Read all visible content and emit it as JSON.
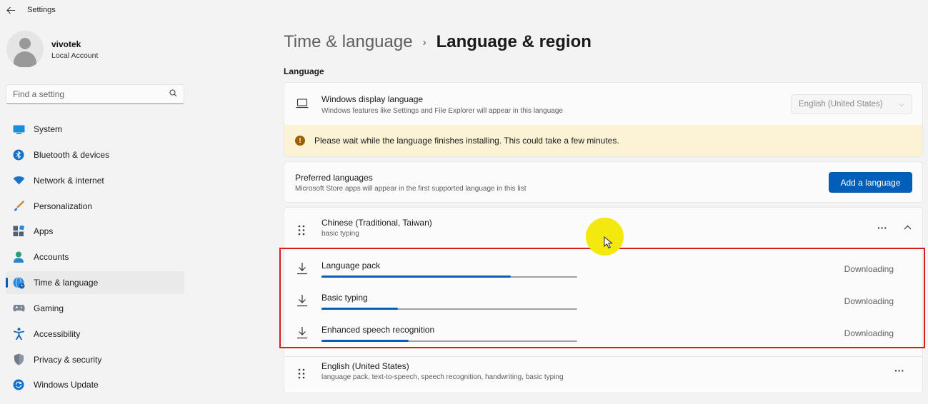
{
  "app": {
    "title": "Settings"
  },
  "user": {
    "name": "vivotek",
    "account_type": "Local Account"
  },
  "search": {
    "placeholder": "Find a setting"
  },
  "nav": {
    "items": [
      {
        "label": "System",
        "icon": "monitor-icon"
      },
      {
        "label": "Bluetooth & devices",
        "icon": "bluetooth-icon"
      },
      {
        "label": "Network & internet",
        "icon": "wifi-icon"
      },
      {
        "label": "Personalization",
        "icon": "brush-icon"
      },
      {
        "label": "Apps",
        "icon": "apps-icon"
      },
      {
        "label": "Accounts",
        "icon": "person-icon"
      },
      {
        "label": "Time & language",
        "icon": "globe-clock-icon",
        "active": true
      },
      {
        "label": "Gaming",
        "icon": "gamepad-icon"
      },
      {
        "label": "Accessibility",
        "icon": "accessibility-icon"
      },
      {
        "label": "Privacy & security",
        "icon": "shield-icon"
      },
      {
        "label": "Windows Update",
        "icon": "update-icon"
      }
    ]
  },
  "breadcrumb": {
    "parent": "Time & language",
    "separator": "›",
    "current": "Language & region"
  },
  "language_section": {
    "label": "Language",
    "display_language": {
      "title": "Windows display language",
      "subtitle": "Windows features like Settings and File Explorer will appear in this language",
      "value": "English (United States)"
    },
    "warning": "Please wait while the language finishes installing. This could take a few minutes.",
    "preferred": {
      "title": "Preferred languages",
      "subtitle": "Microsoft Store apps will appear in the first supported language in this list",
      "add_button": "Add a language"
    },
    "languages": [
      {
        "name": "Chinese (Traditional, Taiwan)",
        "features": "basic typing",
        "expanded": true,
        "downloads": [
          {
            "label": "Language pack",
            "status": "Downloading",
            "progress": 0.74
          },
          {
            "label": "Basic typing",
            "status": "Downloading",
            "progress": 0.3
          },
          {
            "label": "Enhanced speech recognition",
            "status": "Downloading",
            "progress": 0.34
          }
        ]
      },
      {
        "name": "English (United States)",
        "features": "language pack, text-to-speech, speech recognition, handwriting, basic typing"
      }
    ]
  },
  "colors": {
    "accent": "#005fb8",
    "warning_bg": "#fcf2d6",
    "highlight": "#d21e1e",
    "cursor_halo": "#f3e90f"
  }
}
